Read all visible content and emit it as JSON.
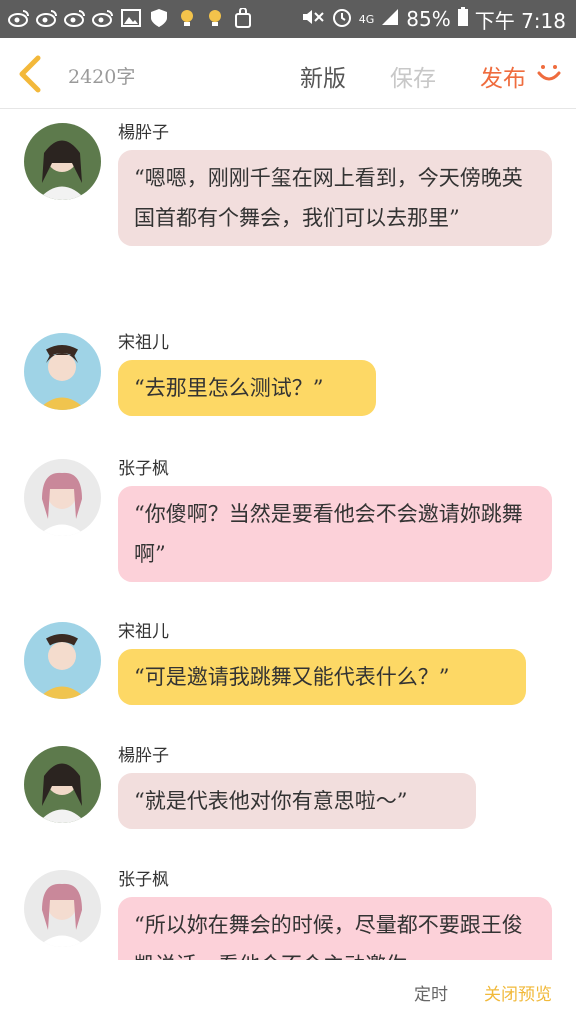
{
  "status_bar": {
    "battery": "85%",
    "time": "下午 7:18",
    "network": "4G",
    "icons": [
      "weibo-icon",
      "weibo-icon",
      "weibo-icon",
      "weibo-icon",
      "image-icon",
      "shield-icon",
      "bulb-icon",
      "bulb-icon",
      "bag-icon",
      "mute-icon",
      "alarm-icon",
      "network-4g-icon",
      "signal-icon",
      "battery-icon"
    ]
  },
  "header": {
    "word_count": "2420字",
    "new_version": "新版",
    "save": "保存",
    "publish": "发布"
  },
  "messages": [
    {
      "name": "楊肸子",
      "text": "“嗯嗯，刚刚千玺在网上看到，今天傍晚英国首都有个舞会，我们可以去那里”",
      "color": "beige"
    },
    {
      "name": "宋祖儿",
      "text": "“去那里怎么测试？”",
      "color": "yellow"
    },
    {
      "name": "张子枫",
      "text": "“你傻啊？当然是要看他会不会邀请妳跳舞啊”",
      "color": "pink"
    },
    {
      "name": "宋祖儿",
      "text": "“可是邀请我跳舞又能代表什么？”",
      "color": "yellow"
    },
    {
      "name": "楊肸子",
      "text": "“就是代表他对你有意思啦～”",
      "color": "beige"
    },
    {
      "name": "张子枫",
      "text": "“所以妳在舞会的时候，尽量都不要跟王俊凯说话，看他会不会主动邀你",
      "color": "pink"
    }
  ],
  "footer": {
    "schedule": "定时",
    "close_preview": "关闭预览"
  },
  "colors": {
    "accent_publish": "#ef6c3e",
    "bubble_beige": "#f2dedd",
    "bubble_yellow": "#fdd865",
    "bubble_pink": "#fcd1d9",
    "close_preview": "#f1b93a"
  }
}
